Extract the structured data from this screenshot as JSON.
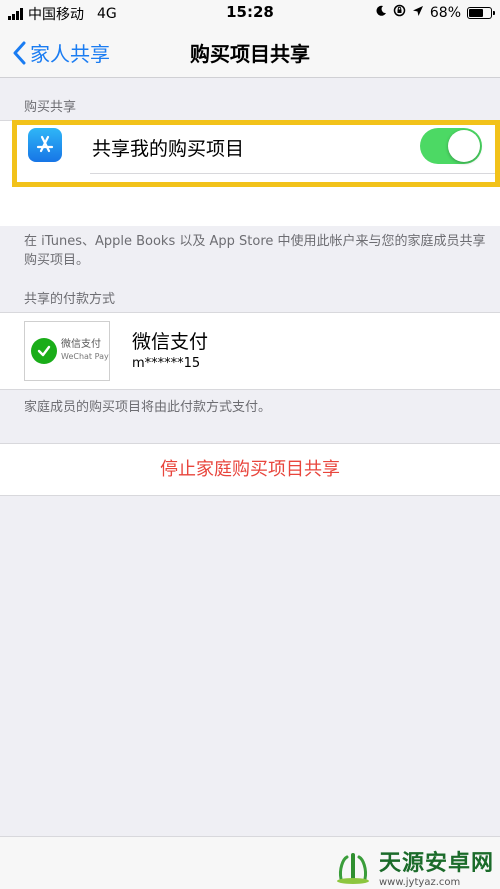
{
  "status_bar": {
    "carrier": "中国移动",
    "network": "4G",
    "time": "15:28",
    "battery": "68%",
    "battery_level": 0.68,
    "icons": [
      "signal-icon",
      "moon-icon",
      "orientation-lock-icon",
      "location-icon",
      "battery-icon"
    ]
  },
  "nav": {
    "back_label": "家人共享",
    "title": "购买项目共享"
  },
  "purchase_section": {
    "header": "购买共享",
    "toggle_label": "共享我的购买项目",
    "toggle_on": true,
    "toggle_color": "#4cd964",
    "footer": "在 iTunes、Apple Books 以及 App Store 中使用此帐户来与您的家庭成员共享购买项目。"
  },
  "payment_section": {
    "header": "共享的付款方式",
    "logo_text_cn": "微信支付",
    "logo_text_en": "WeChat Pay",
    "method_name": "微信支付",
    "account": "m******15",
    "footer": "家庭成员的购买项目将由此付款方式支付。"
  },
  "stop_sharing": {
    "label": "停止家庭购买项目共享",
    "color": "#e8453c"
  },
  "watermark": {
    "title": "天源安卓网",
    "url": "www.jytyaz.com"
  },
  "colors": {
    "accent": "#1a7cf2",
    "highlight_border": "#f2c21a",
    "background": "#efeff4"
  }
}
